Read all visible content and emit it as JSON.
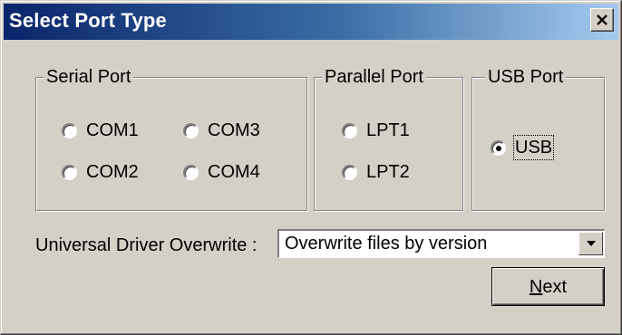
{
  "window": {
    "title": "Select Port Type"
  },
  "serial_port": {
    "legend": "Serial Port",
    "options": [
      {
        "label": "COM1",
        "selected": false
      },
      {
        "label": "COM3",
        "selected": false
      },
      {
        "label": "COM2",
        "selected": false
      },
      {
        "label": "COM4",
        "selected": false
      }
    ]
  },
  "parallel_port": {
    "legend": "Parallel Port",
    "options": [
      {
        "label": "LPT1",
        "selected": false
      },
      {
        "label": "LPT2",
        "selected": false
      }
    ]
  },
  "usb_port": {
    "legend": "USB Port",
    "options": [
      {
        "label": "USB",
        "selected": true
      }
    ]
  },
  "driver_overwrite": {
    "label": "Universal Driver Overwrite :",
    "value": "Overwrite files by version"
  },
  "buttons": {
    "next_mnemonic": "N",
    "next_rest": "ext"
  },
  "icons": {
    "close": "close-icon",
    "dropdown": "chevron-down-icon"
  }
}
